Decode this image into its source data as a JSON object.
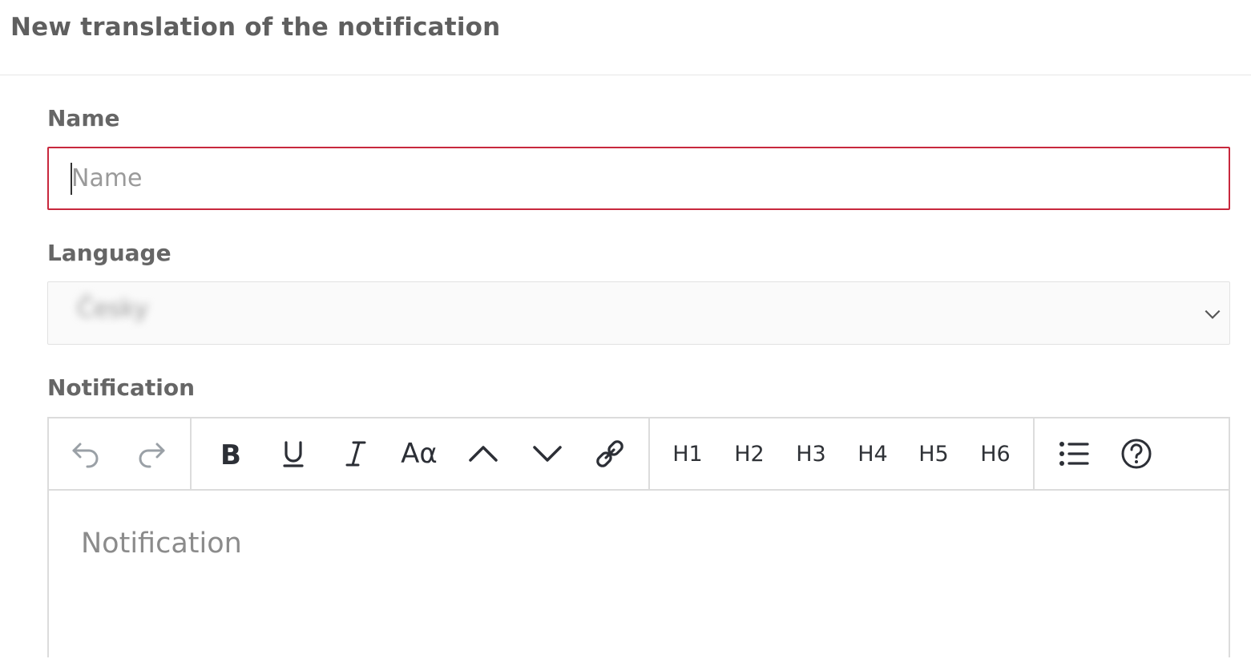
{
  "header": {
    "title": "New translation of the notification"
  },
  "form": {
    "name": {
      "label": "Name",
      "placeholder": "Name",
      "value": ""
    },
    "language": {
      "label": "Language",
      "selected": "Česky"
    },
    "notification": {
      "label": "Notification",
      "placeholder": "Notification"
    }
  },
  "toolbar": {
    "headings": [
      "H1",
      "H2",
      "H3",
      "H4",
      "H5",
      "H6"
    ],
    "font_size_label": "Aα"
  },
  "colors": {
    "error_border": "#c8283d",
    "label": "#666666",
    "icon": "#2c2f36",
    "icon_disabled": "#9aa0a6"
  }
}
